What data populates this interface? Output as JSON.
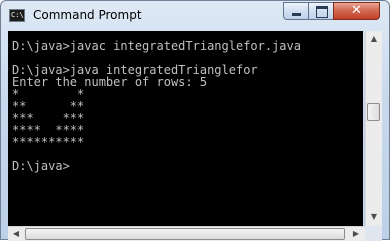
{
  "window": {
    "title": "Command Prompt",
    "icon": "cmd-icon",
    "icon_text": "C:\\",
    "buttons": {
      "minimize": "minimize-icon",
      "maximize": "maximize-icon",
      "close_glyph": "✕"
    }
  },
  "console": {
    "lines": [
      "D:\\java>javac integratedTrianglefor.java",
      "",
      "D:\\java>java integratedTrianglefor",
      "Enter the number of rows: 5",
      "*        *",
      "**      **",
      "***    ***",
      "****  ****",
      "**********",
      "",
      "D:\\java>"
    ],
    "colors": {
      "background": "#000000",
      "text": "#c0c0c0"
    }
  },
  "scrollbars": {
    "up_arrow": "▲",
    "down_arrow": "▼",
    "left_arrow": "◀",
    "right_arrow": "▶"
  }
}
